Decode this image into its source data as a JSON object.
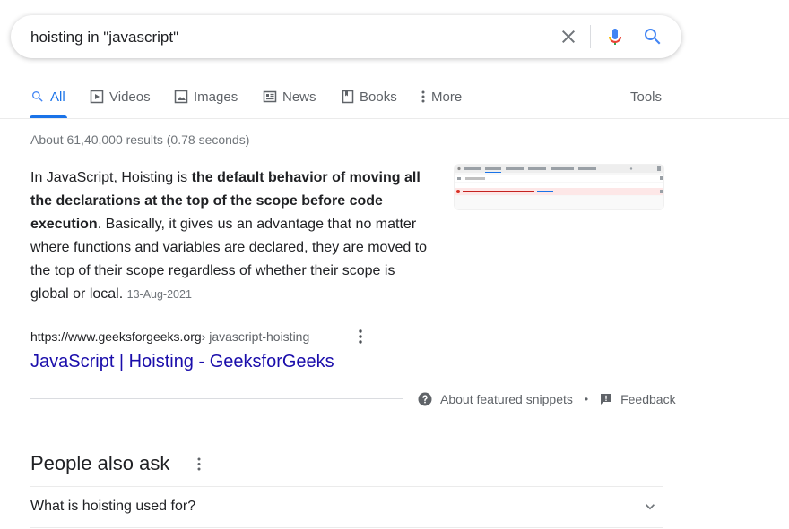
{
  "search": {
    "query": "hoisting in \"javascript\""
  },
  "tabs": [
    {
      "label": "All",
      "icon": "search-icon",
      "active": true
    },
    {
      "label": "Videos",
      "icon": "video-icon"
    },
    {
      "label": "Images",
      "icon": "image-icon"
    },
    {
      "label": "News",
      "icon": "news-icon"
    },
    {
      "label": "Books",
      "icon": "book-icon"
    },
    {
      "label": "More",
      "icon": "kebab-icon"
    }
  ],
  "tools_label": "Tools",
  "result_stats": "About 61,40,000 results (0.78 seconds)",
  "featured_snippet": {
    "text_before": "In JavaScript, Hoisting is ",
    "text_bold": "the default behavior of moving all the declarations at the top of the scope before code execution",
    "text_after": ". Basically, it gives us an advantage that no matter where functions and variables are declared, they are moved to the top of their scope regardless of whether their scope is global or local.",
    "date": "13-Aug-2021",
    "url_domain": "https://www.geeksforgeeks.org",
    "url_path": " › javascript-hoisting",
    "title": "JavaScript | Hoisting - GeeksforGeeks",
    "footer_about": "About featured snippets",
    "footer_sep": "•",
    "footer_feedback": "Feedback"
  },
  "people_also_ask": {
    "heading": "People also ask",
    "questions": [
      "What is hoisting used for?"
    ]
  },
  "colors": {
    "link_blue": "#1a0dab",
    "accent_blue": "#1a73e8",
    "secondary_text": "#5f6368"
  }
}
